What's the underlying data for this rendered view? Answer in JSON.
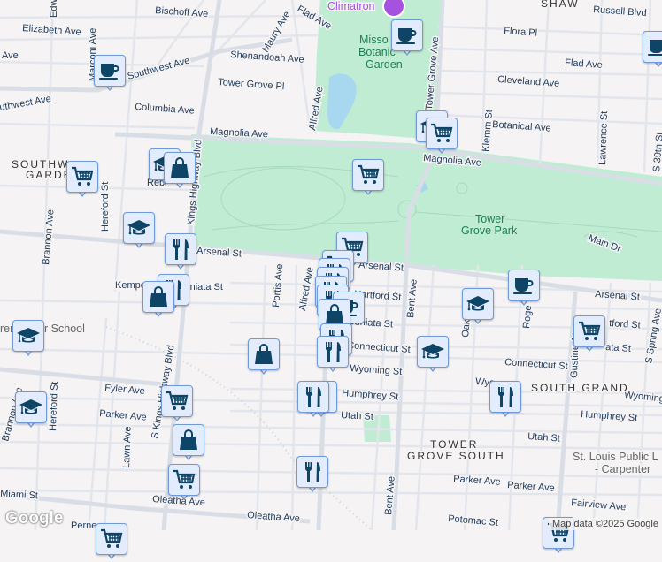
{
  "map": {
    "colors": {
      "background": "#f5f3f4",
      "park": "#c0ecd3",
      "water": "#a8d8f0",
      "road": "#d9dee6",
      "marker_fill": "#e3ecfc",
      "marker_border": "#6f9ad8",
      "icon": "#0e4466",
      "climatron": "#a652e0"
    },
    "streets": {
      "bischoff": "Bischoff Ave",
      "elizabeth": "Elizabeth Ave",
      "edw": "Edw",
      "ave_left": "Ave",
      "marconi": "Marconi Ave",
      "southwest1": "Southwest Ave",
      "southwest2": "uthwest Ave",
      "shenandoah": "Shenandoah Ave",
      "maury": "Maury Ave",
      "flad1": "Flad Ave",
      "tgpl": "Tower Grove Pl",
      "columbia": "Columbia Ave",
      "alfred1": "Alfred Ave",
      "magnolia1": "Magnolia Ave",
      "magnolia2": "Magnolia Ave",
      "kings": "Kings Highway Blvd",
      "rebl": "Rebl",
      "hereford1": "Hereford St",
      "brannon1": "Brannon Ave",
      "arsenal1": "Arsenal St",
      "arsenal2": "Arsenal St",
      "arsenal3": "Arsenal St",
      "kemper": "Kemper",
      "juniata1": "Juniata St",
      "portis": "Portis Ave",
      "alfred2": "Alfred Ave",
      "tgave": "Tower Grove Ave",
      "russell": "Russell Blvd",
      "flora": "Flora Pl",
      "flad2": "Flad Ave",
      "cleveland": "Cleveland Ave",
      "botanical": "Botanical Ave",
      "klemm": "Klemm St",
      "lawrence": "Lawrence St",
      "s39": "S 39th St",
      "maindr": "Main Dr",
      "hartford1": "Hartford St",
      "juniata2": "Juniata St",
      "bent1": "Bent Ave",
      "oak": "Oak",
      "roger": "Roge",
      "connecticut1": "Connecticut St",
      "connecticut2": "Connecticut St",
      "wyoming1": "Wyoming St",
      "wyoming2": "Wyo",
      "wyoming3": "Wyoming",
      "humphrey1": "Humphrey St",
      "humphrey2": "Humphrey St",
      "utah1": "Utah St",
      "utah2": "Utah St",
      "hartford2": "tford St",
      "juniata3": "ata St",
      "gustine": "Gustine Ave",
      "spring": "S Spring Ave",
      "fyler": "Fyler Ave",
      "parker1": "Parker Ave",
      "parker2": "Parker Ave",
      "parker3": "Parker Ave",
      "hereford2": "Hereford St",
      "brannon2": "Brannon Ave",
      "lawn": "Lawn Ave",
      "skings": "S Kings Highway Blvd",
      "miami": "Miami St",
      "oleatha1": "Oleatha Ave",
      "oleatha2": "Oleatha Ave",
      "perne": "Perne",
      "bent2": "Bent Ave",
      "fairview": "Fairview Ave",
      "potomac": "Potomac St"
    },
    "neighborhoods": {
      "southwest_garden_1": "SOUTHW",
      "southwest_garden_2": "GARDE",
      "south_grand": "SOUTH GRAND",
      "tgs1": "TOWER",
      "tgs2": "GROVE SOUTH",
      "shaw": "SHAW"
    },
    "parks": {
      "garden1": "Misso",
      "garden2": "Botanic",
      "garden3": "Garden",
      "tgp1": "Tower",
      "tgp2": "Grove Park"
    },
    "pois": {
      "climatron": "Climatron",
      "charter": "ren    harter School",
      "library1": "St. Louis Public L",
      "library2": "- Carpenter"
    },
    "attribution": "Map data ©2025 Google",
    "logo": "Google"
  }
}
